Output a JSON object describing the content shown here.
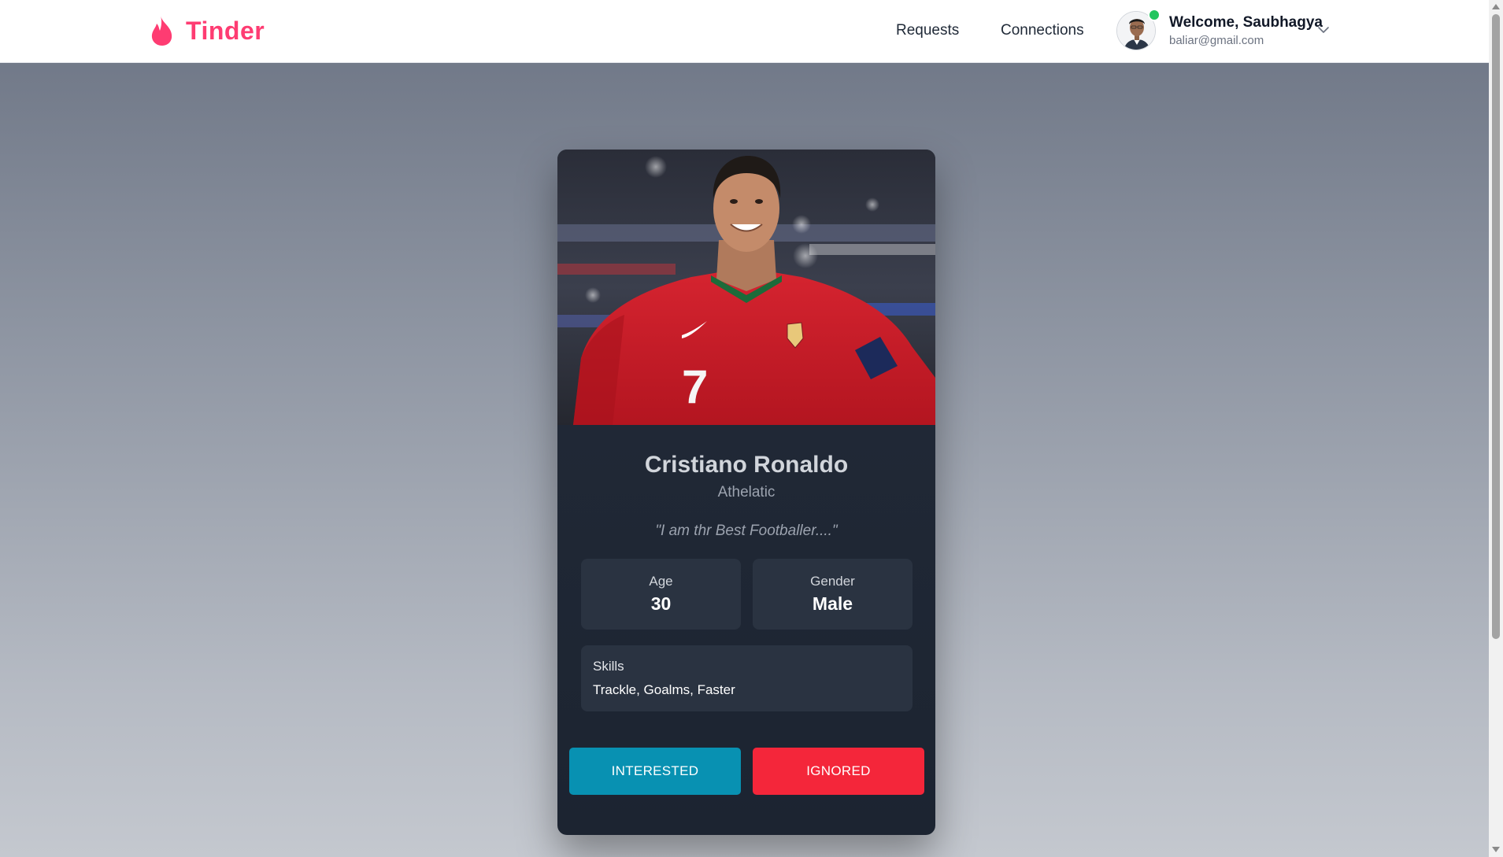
{
  "navbar": {
    "brand": "Tinder",
    "brand_color": "#fe3c72",
    "links": [
      {
        "label": "Requests"
      },
      {
        "label": "Connections"
      }
    ],
    "user": {
      "welcome": "Welcome, Saubhagya",
      "email": "baliar@gmail.com",
      "online_status_color": "#22c55e"
    }
  },
  "card": {
    "name": "Cristiano Ronaldo",
    "profession": "Athelatic",
    "about": "\"I am thr Best Footballer....\"",
    "photo_jersey_number": "7",
    "stats": [
      {
        "label": "Age",
        "value": "30"
      },
      {
        "label": "Gender",
        "value": "Male"
      }
    ],
    "skills": {
      "label": "Skills",
      "value": "Trackle, Goalms, Faster"
    },
    "actions": {
      "interested": "INTERESTED",
      "ignored": "IGNORED",
      "interested_color": "#0891b2",
      "ignored_color": "#f4263a"
    }
  }
}
